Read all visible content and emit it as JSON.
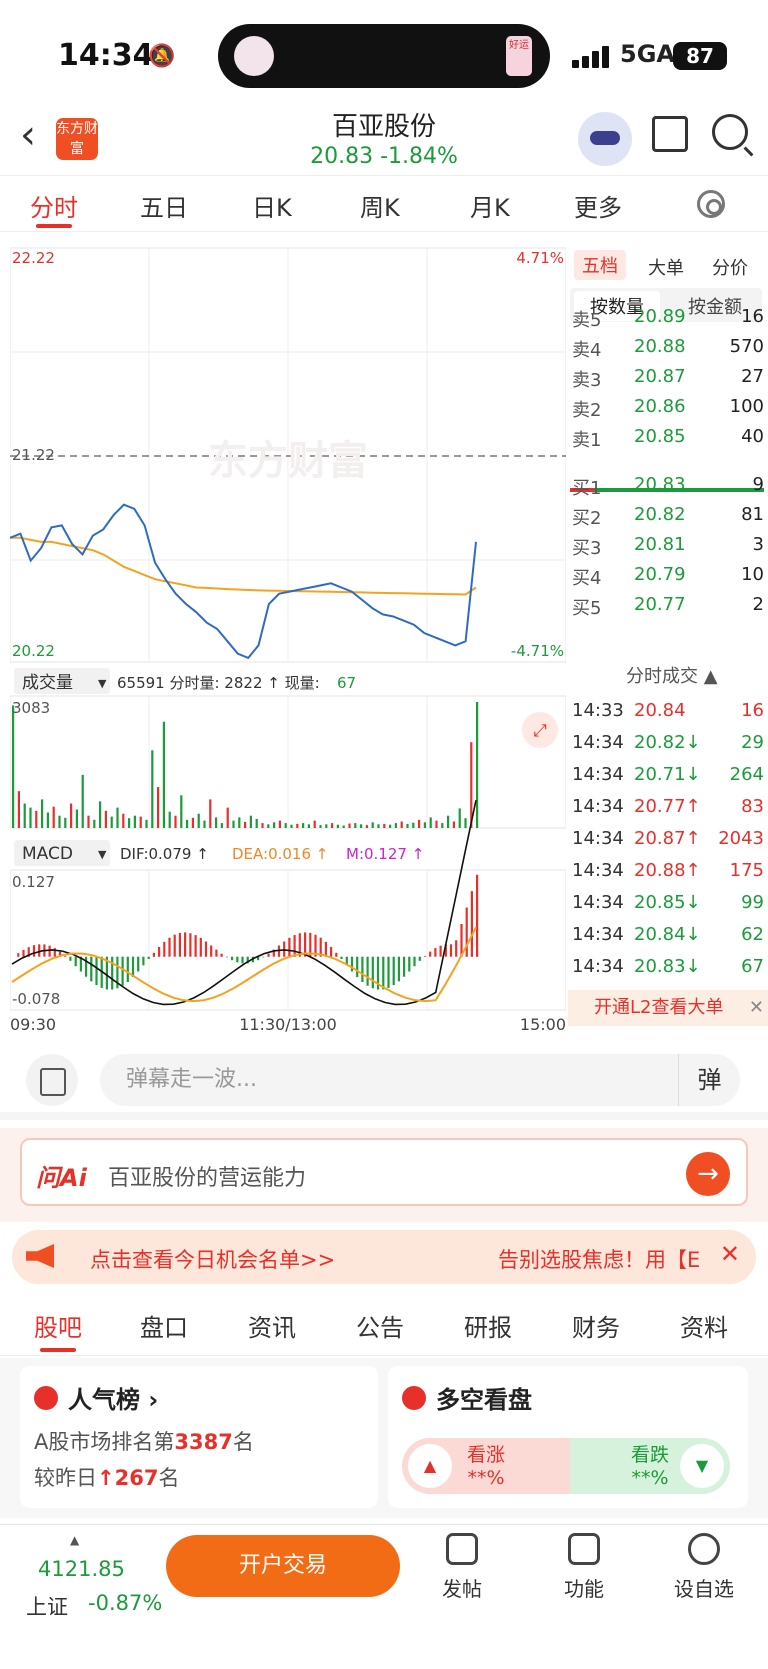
{
  "status": {
    "time": "14:34",
    "network": "5GA",
    "battery": "87",
    "island_tag": "好运"
  },
  "header": {
    "back": "‹",
    "logo": "东方财富",
    "title": "百亚股份",
    "price_line": "20.83  -1.84%"
  },
  "tabs": [
    "分时",
    "五日",
    "日K",
    "周K",
    "月K",
    "更多"
  ],
  "chart": {
    "price_high": "22.22",
    "price_mid": "21.22",
    "price_low": "20.22",
    "pct_high": "4.71%",
    "pct_low": "-4.71%",
    "watermark": "东方财富",
    "vol_selector": "成交量",
    "vol_info_a": "65591 分时量: 2822 ↑ 现量: ",
    "vol_info_b": "67",
    "vol_max": "3083",
    "macd_selector": "MACD",
    "dif": "DIF:0.079 ↑",
    "dea": "DEA:0.016 ↑",
    "m": "M:0.127 ↑",
    "macd_high": "0.127",
    "macd_low": "-0.078",
    "time_start": "09:30",
    "time_mid": "11:30/13:00",
    "time_end": "15:00"
  },
  "chart_data": {
    "type": "line",
    "price_range": [
      20.22,
      22.22
    ],
    "prev_close": 21.22,
    "price_series": [
      20.82,
      20.84,
      20.71,
      20.77,
      20.87,
      20.88,
      20.79,
      20.74,
      20.83,
      20.86,
      20.93,
      20.98,
      20.96,
      20.88,
      20.7,
      20.62,
      20.55,
      20.5,
      20.46,
      20.41,
      20.38,
      20.32,
      20.26,
      20.24,
      20.3,
      20.5,
      20.55,
      20.56,
      20.57,
      20.58,
      20.59,
      20.6,
      20.58,
      20.56,
      20.52,
      20.48,
      20.45,
      20.44,
      20.42,
      20.4,
      20.36,
      20.34,
      20.32,
      20.3,
      20.32,
      20.8
    ],
    "avg_series": [
      20.82,
      20.82,
      20.81,
      20.8,
      20.8,
      20.79,
      20.78,
      20.77,
      20.76,
      20.74,
      20.71,
      20.68,
      20.66,
      20.64,
      20.62,
      20.61,
      20.6,
      20.59,
      20.58,
      20.578,
      20.575,
      20.572,
      20.57,
      20.568,
      20.566,
      20.565,
      20.564,
      20.563,
      20.562,
      20.561,
      20.56,
      20.559,
      20.558,
      20.557,
      20.556,
      20.555,
      20.554,
      20.553,
      20.552,
      20.551,
      20.55,
      20.549,
      20.548,
      20.547,
      20.546,
      20.58
    ],
    "volume_max": 3083,
    "macd_range": [
      -0.078,
      0.127
    ]
  },
  "orderbook": {
    "tabs": [
      "五档",
      "大单",
      "分价"
    ],
    "seg": [
      "按数量",
      "按金额"
    ],
    "sell": [
      {
        "l": "卖5",
        "p": "20.89",
        "v": "16"
      },
      {
        "l": "卖4",
        "p": "20.88",
        "v": "570"
      },
      {
        "l": "卖3",
        "p": "20.87",
        "v": "27"
      },
      {
        "l": "卖2",
        "p": "20.86",
        "v": "100"
      },
      {
        "l": "卖1",
        "p": "20.85",
        "v": "40"
      }
    ],
    "buy": [
      {
        "l": "买1",
        "p": "20.83",
        "v": "9"
      },
      {
        "l": "买2",
        "p": "20.82",
        "v": "81"
      },
      {
        "l": "买3",
        "p": "20.81",
        "v": "3"
      },
      {
        "l": "买4",
        "p": "20.79",
        "v": "10"
      },
      {
        "l": "买5",
        "p": "20.77",
        "v": "2"
      }
    ],
    "ticks_title": "分时成交 ▲",
    "ticks": [
      {
        "t": "14:33",
        "p": "20.84",
        "v": "16",
        "c": "red"
      },
      {
        "t": "14:34",
        "p": "20.82↓",
        "v": "29",
        "c": "green"
      },
      {
        "t": "14:34",
        "p": "20.71↓",
        "v": "264",
        "c": "green"
      },
      {
        "t": "14:34",
        "p": "20.77↑",
        "v": "83",
        "c": "red"
      },
      {
        "t": "14:34",
        "p": "20.87↑",
        "v": "2043",
        "c": "red"
      },
      {
        "t": "14:34",
        "p": "20.88↑",
        "v": "175",
        "c": "red"
      },
      {
        "t": "14:34",
        "p": "20.85↓",
        "v": "99",
        "c": "green"
      },
      {
        "t": "14:34",
        "p": "20.84↓",
        "v": "62",
        "c": "green"
      },
      {
        "t": "14:34",
        "p": "20.83↓",
        "v": "67",
        "c": "green"
      }
    ],
    "l2": "开通L2查看大单"
  },
  "danmu": {
    "placeholder": "弹幕走一波...",
    "button": "弹"
  },
  "ai": {
    "label": "问Ai",
    "question": "百亚股份的营运能力"
  },
  "promo": {
    "left": "点击查看今日机会名单>>",
    "right": "告别选股焦虑！用【E",
    "close": "✕"
  },
  "bottom_tabs": [
    "股吧",
    "盘口",
    "资讯",
    "公告",
    "研报",
    "财务",
    "资料"
  ],
  "popularity": {
    "title": "人气榜",
    "rank_prefix": "A股市场排名第",
    "rank": "3387",
    "rank_suffix": "名",
    "change_prefix": "较昨日",
    "change": "267",
    "change_suffix": "名"
  },
  "bullbear": {
    "title": "多空看盘",
    "up": "看涨",
    "up_pct": "**%",
    "down": "看跌",
    "down_pct": "**%"
  },
  "footer": {
    "index_value": "4121.85",
    "index_name": "上证",
    "index_change": "-0.87%",
    "trade": "开户交易",
    "post": "发帖",
    "func": "功能",
    "watch": "设自选"
  }
}
